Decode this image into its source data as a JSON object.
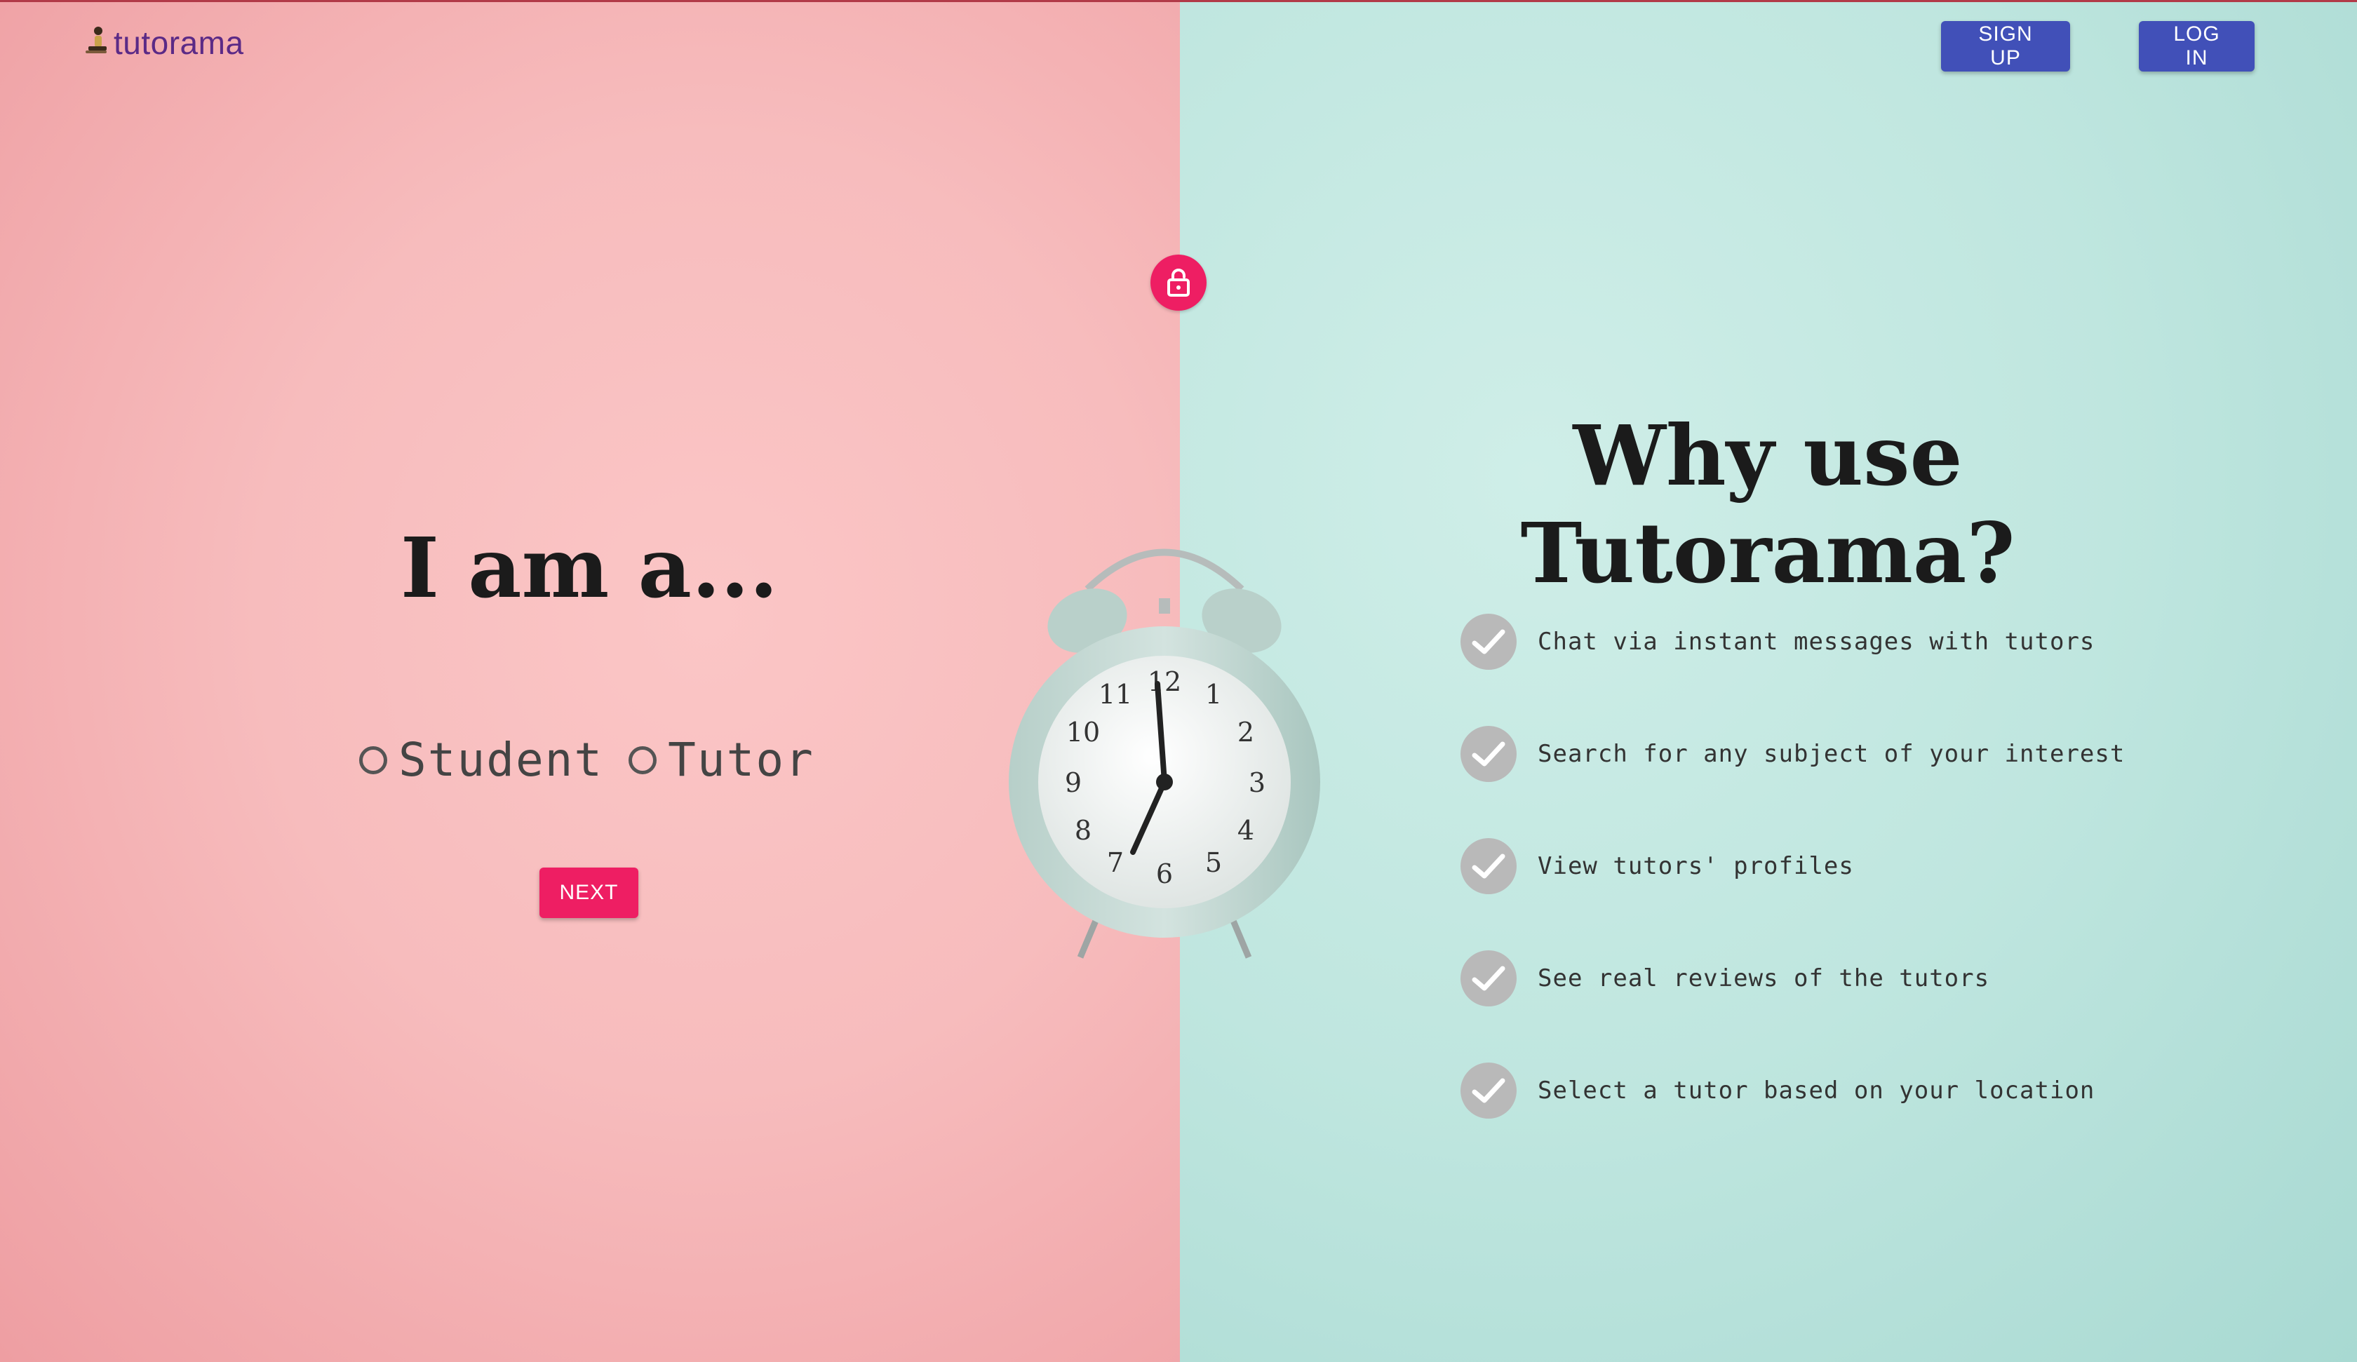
{
  "header": {
    "logo_text": "tutorama",
    "signup_label": "SIGN UP",
    "login_label": "LOG IN"
  },
  "lock": {
    "icon": "lock-icon",
    "color": "#ee1e63"
  },
  "left": {
    "title": "I am a...",
    "roles": [
      {
        "label": "Student",
        "selected": false
      },
      {
        "label": "Tutor",
        "selected": false
      }
    ],
    "next_label": "NEXT"
  },
  "right": {
    "title": "Why use Tutorama?",
    "features": [
      "Chat via instant messages with tutors",
      "Search for any subject of your interest",
      "View tutors' profiles",
      "See real reviews of the tutors",
      "Select a tutor based on your location"
    ]
  },
  "colors": {
    "left_bg": "#f7bcbd",
    "right_bg": "#bfe6df",
    "nav_button": "#4150b8",
    "accent": "#ee1e63",
    "logo": "#5b2a86"
  }
}
